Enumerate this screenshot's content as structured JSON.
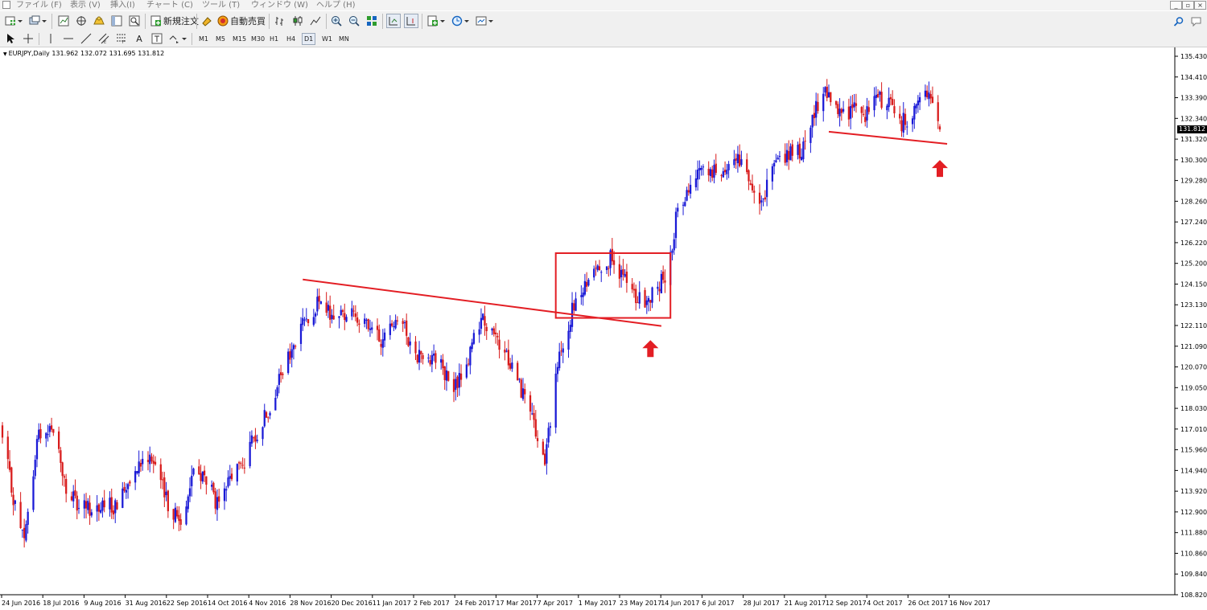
{
  "window": {
    "menu_items": [
      "ファイル (F)",
      "表示 (V)",
      "挿入(I)",
      "チャート (C)",
      "ツール (T)",
      "ウィンドウ (W)",
      "ヘルプ (H)"
    ],
    "controls": [
      "minimize-icon",
      "restore-icon",
      "close-icon"
    ]
  },
  "toolbar": {
    "new_order_label": "新規注文",
    "auto_trade_label": "自動売買",
    "timeframes": [
      "M1",
      "M5",
      "M15",
      "M30",
      "H1",
      "H4",
      "D1",
      "W1",
      "MN"
    ],
    "active_timeframe": "D1",
    "text_tool_label": "A"
  },
  "chart": {
    "header": "EURJPY,Daily  131.962 132.072 131.695 131.812",
    "current_price": "131.812",
    "colors": {
      "bull": "#1a1ad6",
      "bear": "#d81b1b",
      "annotation": "#e31e24"
    }
  },
  "chart_data": {
    "type": "candlestick",
    "symbol": "EURJPY",
    "timeframe": "Daily",
    "ohlc_last": {
      "open": 131.962,
      "high": 132.072,
      "low": 131.695,
      "close": 131.812
    },
    "y_ticks": [
      "135.430",
      "134.410",
      "133.390",
      "132.340",
      "131.320",
      "130.300",
      "129.280",
      "128.260",
      "127.240",
      "126.220",
      "125.200",
      "124.150",
      "123.130",
      "122.110",
      "121.090",
      "120.070",
      "119.050",
      "118.030",
      "117.010",
      "115.960",
      "114.940",
      "113.920",
      "112.900",
      "111.880",
      "110.860",
      "109.840",
      "108.820"
    ],
    "y_range": [
      108.82,
      135.43
    ],
    "x_ticks": [
      "24 Jun 2016",
      "18 Jul 2016",
      "9 Aug 2016",
      "31 Aug 2016",
      "22 Sep 2016",
      "14 Oct 2016",
      "4 Nov 2016",
      "28 Nov 2016",
      "20 Dec 2016",
      "11 Jan 2017",
      "2 Feb 2017",
      "24 Feb 2017",
      "17 Mar 2017",
      "7 Apr 2017",
      "1 May 2017",
      "23 May 2017",
      "14 Jun 2017",
      "6 Jul 2017",
      "28 Jul 2017",
      "21 Aug 2017",
      "12 Sep 2017",
      "4 Oct 2017",
      "26 Oct 2017",
      "16 Nov 2017"
    ],
    "x_range": [
      "2016-06-24",
      "2017-11-21"
    ],
    "path_key_points": [
      [
        "2016-06-24",
        116.5
      ],
      [
        "2016-07-01",
        113.2
      ],
      [
        "2016-07-06",
        111.4
      ],
      [
        "2016-07-14",
        116.9
      ],
      [
        "2016-07-22",
        117.1
      ],
      [
        "2016-07-29",
        114.0
      ],
      [
        "2016-08-05",
        113.1
      ],
      [
        "2016-08-26",
        113.2
      ],
      [
        "2016-09-05",
        115.3
      ],
      [
        "2016-09-14",
        115.8
      ],
      [
        "2016-09-22",
        113.5
      ],
      [
        "2016-09-30",
        112.4
      ],
      [
        "2016-10-07",
        115.0
      ],
      [
        "2016-10-14",
        114.5
      ],
      [
        "2016-10-21",
        113.0
      ],
      [
        "2016-10-28",
        114.8
      ],
      [
        "2016-11-04",
        115.4
      ],
      [
        "2016-11-09",
        116.5
      ],
      [
        "2016-11-17",
        118.0
      ],
      [
        "2016-11-25",
        119.8
      ],
      [
        "2016-12-02",
        121.2
      ],
      [
        "2016-12-07",
        122.5
      ],
      [
        "2016-12-15",
        123.2
      ],
      [
        "2016-12-22",
        122.6
      ],
      [
        "2017-01-03",
        122.8
      ],
      [
        "2017-01-11",
        121.9
      ],
      [
        "2017-01-19",
        121.3
      ],
      [
        "2017-01-26",
        122.7
      ],
      [
        "2017-02-07",
        120.7
      ],
      [
        "2017-02-17",
        120.6
      ],
      [
        "2017-02-27",
        118.9
      ],
      [
        "2017-03-07",
        120.5
      ],
      [
        "2017-03-14",
        122.6
      ],
      [
        "2017-03-22",
        121.3
      ],
      [
        "2017-03-31",
        120.2
      ],
      [
        "2017-04-10",
        117.8
      ],
      [
        "2017-04-14",
        116.3
      ],
      [
        "2017-04-18",
        115.3
      ],
      [
        "2017-04-21",
        117.4
      ],
      [
        "2017-04-24",
        119.7
      ],
      [
        "2017-05-03",
        122.8
      ],
      [
        "2017-05-12",
        124.3
      ],
      [
        "2017-05-16",
        125.1
      ],
      [
        "2017-05-24",
        125.4
      ],
      [
        "2017-05-31",
        124.5
      ],
      [
        "2017-06-08",
        123.3
      ],
      [
        "2017-06-15",
        123.5
      ],
      [
        "2017-06-22",
        124.4
      ],
      [
        "2017-06-26",
        125.4
      ],
      [
        "2017-06-29",
        127.5
      ],
      [
        "2017-07-05",
        128.8
      ],
      [
        "2017-07-12",
        130.0
      ],
      [
        "2017-07-19",
        129.6
      ],
      [
        "2017-07-26",
        130.0
      ],
      [
        "2017-08-02",
        130.4
      ],
      [
        "2017-08-09",
        128.8
      ],
      [
        "2017-08-16",
        128.5
      ],
      [
        "2017-08-23",
        130.2
      ],
      [
        "2017-08-30",
        130.5
      ],
      [
        "2017-09-06",
        130.7
      ],
      [
        "2017-09-14",
        132.8
      ],
      [
        "2017-09-19",
        133.9
      ],
      [
        "2017-09-26",
        132.5
      ],
      [
        "2017-10-04",
        132.8
      ],
      [
        "2017-10-11",
        132.6
      ],
      [
        "2017-10-18",
        133.4
      ],
      [
        "2017-10-24",
        133.1
      ],
      [
        "2017-10-31",
        132.1
      ],
      [
        "2017-11-07",
        132.8
      ],
      [
        "2017-11-13",
        133.7
      ],
      [
        "2017-11-21",
        131.8
      ]
    ],
    "annotations": [
      {
        "type": "trendline",
        "from": [
          "2016-12-06",
          124.4
        ],
        "to": [
          "2017-06-21",
          122.1
        ]
      },
      {
        "type": "trendline",
        "from": [
          "2017-09-21",
          131.7
        ],
        "to": [
          "2017-11-25",
          131.1
        ]
      },
      {
        "type": "rectangle",
        "from": [
          "2017-04-24",
          125.7
        ],
        "to": [
          "2017-06-26",
          122.5
        ]
      },
      {
        "type": "arrow-up",
        "at": [
          "2017-06-15",
          121.4
        ]
      },
      {
        "type": "arrow-up",
        "at": [
          "2017-11-21",
          130.3
        ]
      }
    ]
  }
}
